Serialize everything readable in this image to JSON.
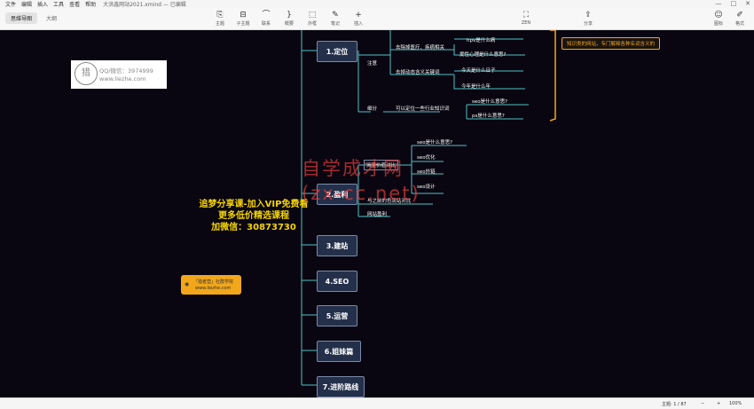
{
  "menu": {
    "items": [
      "文件",
      "编辑",
      "插入",
      "工具",
      "查看",
      "帮助"
    ],
    "doc_title": "大洪鑫网站2021.xmind — 已编辑"
  },
  "tabs": [
    "思维导图",
    "大纲"
  ],
  "toolbar": {
    "tools": [
      "主题",
      "子主题",
      "联系",
      "概要",
      "外框",
      "笔记",
      "插入"
    ],
    "zen": "ZEN",
    "share": "分享",
    "format": "格式",
    "icon_panel": "图标"
  },
  "window_controls": [
    "—",
    "□",
    "✕"
  ],
  "mindmap": {
    "main_nodes": [
      "1.定位",
      "2.盈利",
      "3.建站",
      "4.SEO",
      "5.运营",
      "6.姐妹篇",
      "7.进阶路线"
    ],
    "branch_1": {
      "notice_label": "注意",
      "item_medical": "去除掉医疗、疾病相关",
      "leaf_hpv": "hpv是什么病",
      "leaf_mind": "爱性心理是什么意思?",
      "item_dynamic": "去掉动态含义关键词",
      "leaf_today": "今天是什么日子",
      "leaf_year": "今年是什么年",
      "segment_label": "细分",
      "item_segment": "可以定位一些行业知识词",
      "leaf_seo": "seo是什么意思?",
      "leaf_ps": "ps是什么意思?"
    },
    "branch_2": {
      "item_flow": "流量价值对比",
      "leaf_seo_q": "seo是什么意思?",
      "leaf_seo_opt": "seo优化",
      "leaf_seo_ext": "seo外链",
      "leaf_seo_design": "seo设计",
      "item_compare": "与之前的色流站对比",
      "item_profit": "网站盈利"
    },
    "note_text": "知识类的网站，专门解释各种名词含义的"
  },
  "overlay": {
    "promo_lines": [
      "追梦分享课-加入VIP免费看",
      "更多低价精选课程",
      "加微信：30873730"
    ],
    "watermark_lines": [
      "自学成才网",
      "(zx-cc.net)"
    ],
    "logo_qq": "QQ/微信：3974999",
    "logo_url": "www.liezhe.com",
    "badge_line1": "「猎者营」社群学院",
    "badge_line2": "www.liezhe.com"
  },
  "status": {
    "topic_count": "主题: 1 / 87",
    "zoom": "100%"
  }
}
